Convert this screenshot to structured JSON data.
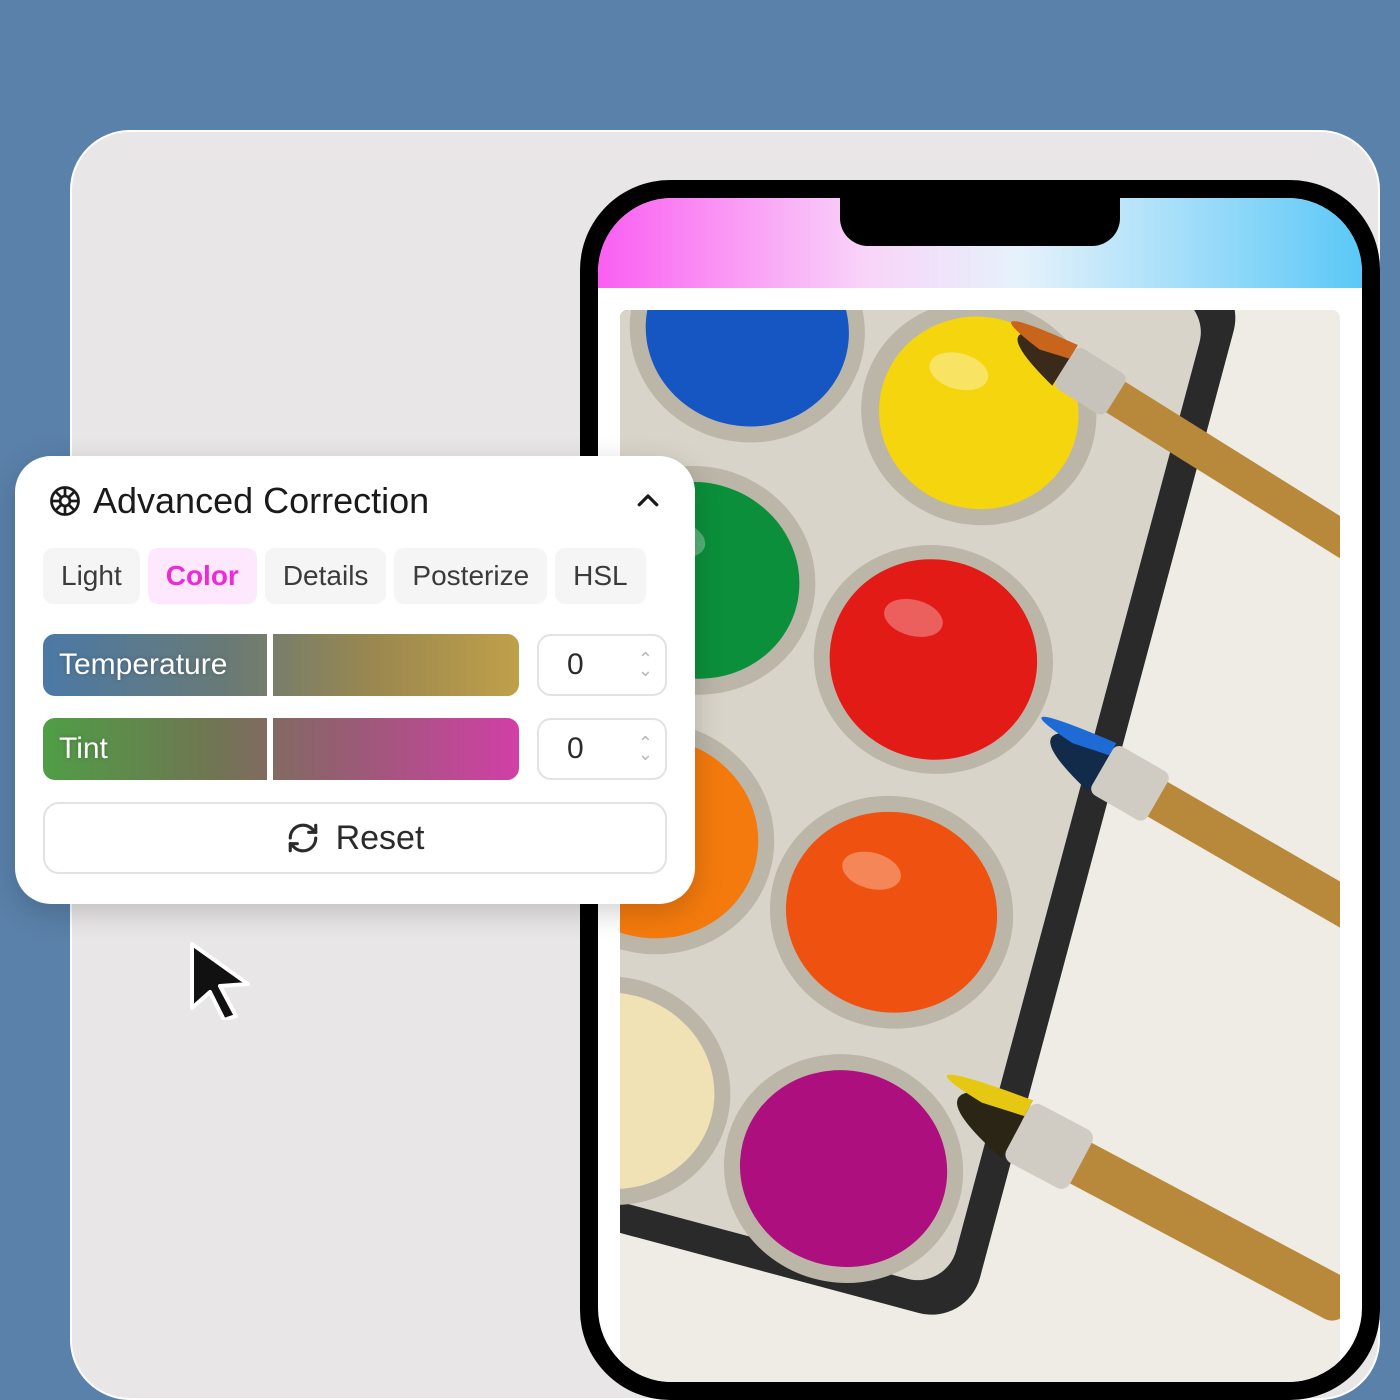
{
  "panel": {
    "title": "Advanced Correction",
    "tabs": [
      "Light",
      "Color",
      "Details",
      "Posterize",
      "HSL"
    ],
    "active_tab": "Color",
    "sliders": {
      "temperature": {
        "label": "Temperature",
        "value": "0"
      },
      "tint": {
        "label": "Tint",
        "value": "0"
      }
    },
    "reset_label": "Reset"
  }
}
